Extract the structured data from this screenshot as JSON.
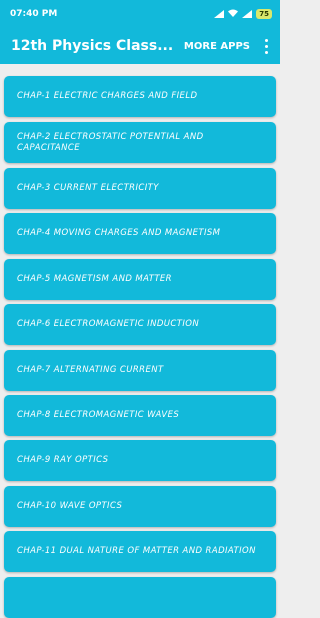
{
  "status_bar": {
    "time": "07:40 PM",
    "battery": "75"
  },
  "app_bar": {
    "title": "12th Physics Class...",
    "more_apps": "MORE APPS"
  },
  "chapters": [
    "CHAP-1 ELECTRIC CHARGES AND FIELD",
    "CHAP-2 ELECTROSTATIC POTENTIAL AND CAPACITANCE",
    "CHAP-3 CURRENT ELECTRICITY",
    "CHAP-4 MOVING CHARGES AND MAGNETISM",
    "CHAP-5 MAGNETISM AND MATTER",
    "CHAP-6 ELECTROMAGNETIC INDUCTION",
    "CHAP-7 ALTERNATING CURRENT",
    "CHAP-8 ELECTROMAGNETIC WAVES",
    "CHAP-9 RAY OPTICS",
    "CHAP-10 WAVE OPTICS",
    "CHAP-11 DUAL NATURE OF MATTER AND RADIATION",
    ""
  ],
  "colors": {
    "primary": "#12b9da",
    "background": "#eeeeee"
  },
  "icons": [
    "signal-icon",
    "wifi-icon",
    "battery-icon",
    "overflow-menu-icon"
  ]
}
